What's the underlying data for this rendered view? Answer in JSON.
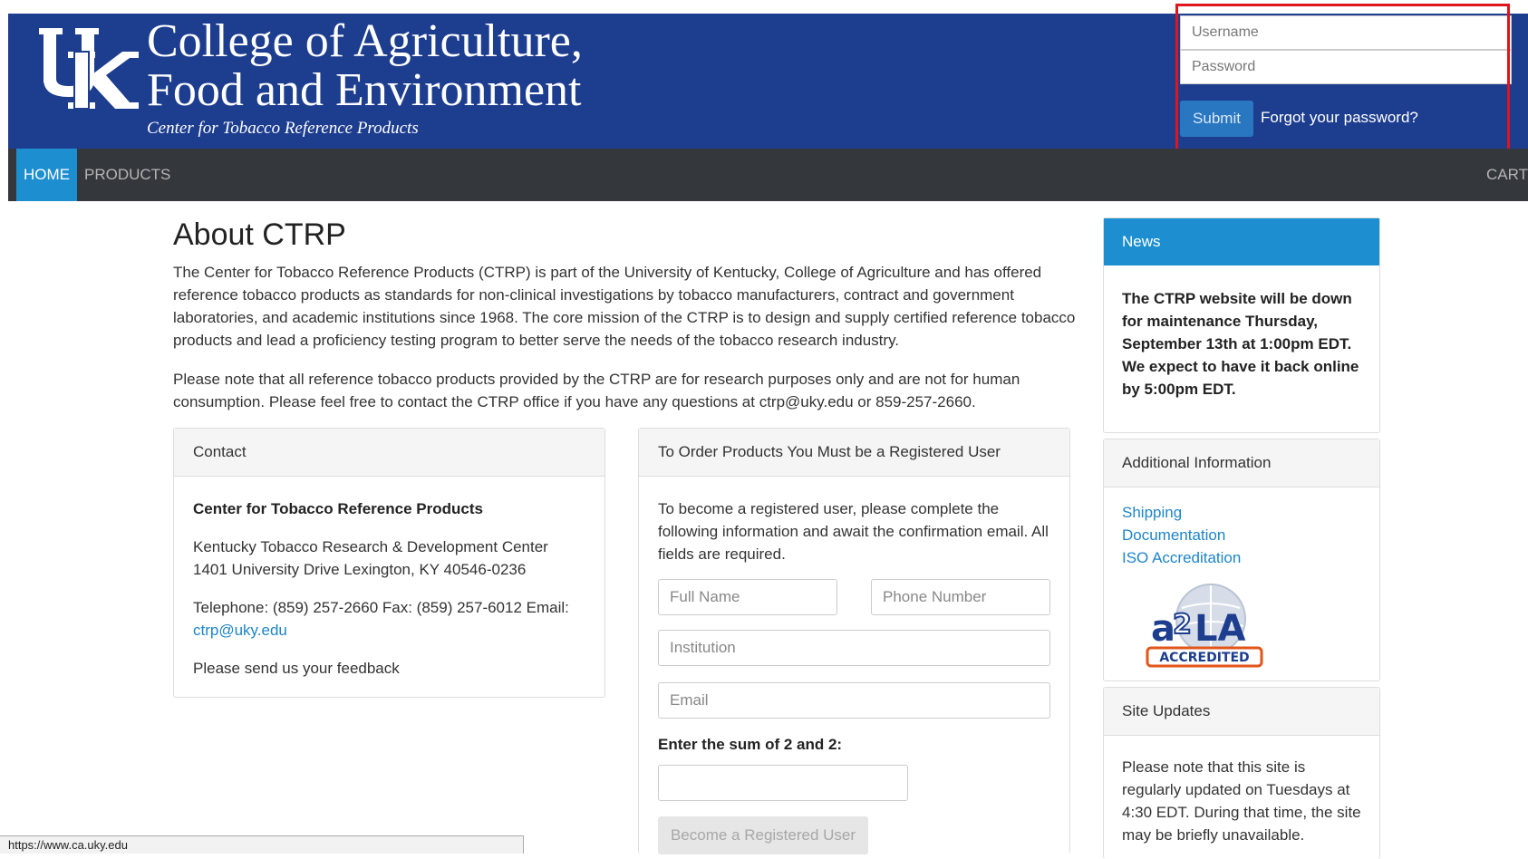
{
  "header": {
    "college_title_line1": "College of Agriculture,",
    "college_title_line2": "Food and Environment",
    "subtitle": "Center for Tobacco Reference Products",
    "colors": {
      "header_bg": "#1d3d8f",
      "accent": "#1d8fd0",
      "annotation": "#e0141b"
    }
  },
  "login": {
    "username_placeholder": "Username",
    "password_placeholder": "Password",
    "submit_label": "Submit",
    "forgot_label": "Forgot your password?"
  },
  "nav": {
    "items": [
      {
        "label": "HOME",
        "active": true
      },
      {
        "label": "PRODUCTS",
        "active": false
      }
    ],
    "cart_label": "CART"
  },
  "main": {
    "title": "About CTRP",
    "intro": "The Center for Tobacco Reference Products (CTRP) is part of the University of Kentucky, College of Agriculture and has offered reference tobacco products as standards for non-clinical investigations by tobacco manufacturers, contract and government laboratories, and academic institutions since 1968. The core mission of the CTRP is to design and supply certified reference tobacco products and lead a proficiency testing program to better serve the needs of the tobacco research industry.",
    "note": "Please note that all reference tobacco products provided by the CTRP are for research purposes only and are not for human consumption. Please feel free to contact the CTRP office if you have any questions at ctrp@uky.edu or 859-257-2660."
  },
  "contact": {
    "heading": "Contact",
    "org": "Center for Tobacco Reference Products",
    "address_line1": "Kentucky Tobacco Research & Development Center",
    "address_line2": "1401 University Drive Lexington, KY 40546-0236",
    "phone_text": "Telephone: (859) 257-2660 Fax: (859) 257-6012 Email:",
    "email": "ctrp@uky.edu",
    "feedback": "Please send us your feedback"
  },
  "register": {
    "heading": "To Order Products You Must be a Registered User",
    "instructions": "To become a registered user, please complete the following information and await the confirmation email. All fields are required.",
    "full_name_placeholder": "Full Name",
    "phone_placeholder": "Phone Number",
    "institution_placeholder": "Institution",
    "email_placeholder": "Email",
    "sum_label": "Enter the sum of 2 and 2:",
    "button_label": "Become a Registered User"
  },
  "news": {
    "heading": "News",
    "body": "The CTRP website will be down for maintenance Thursday, September 13th at 1:00pm EDT. We expect to have it back online by 5:00pm EDT."
  },
  "additional_info": {
    "heading": "Additional Information",
    "links": [
      "Shipping",
      "Documentation",
      "ISO Accreditation"
    ],
    "badge_text": "ACCREDITED"
  },
  "site_updates": {
    "heading": "Site Updates",
    "body": "Please note that this site is regularly updated on Tuesdays at 4:30 EDT. During that time, the site may be briefly unavailable."
  },
  "status_bar": {
    "url": "https://www.ca.uky.edu"
  }
}
